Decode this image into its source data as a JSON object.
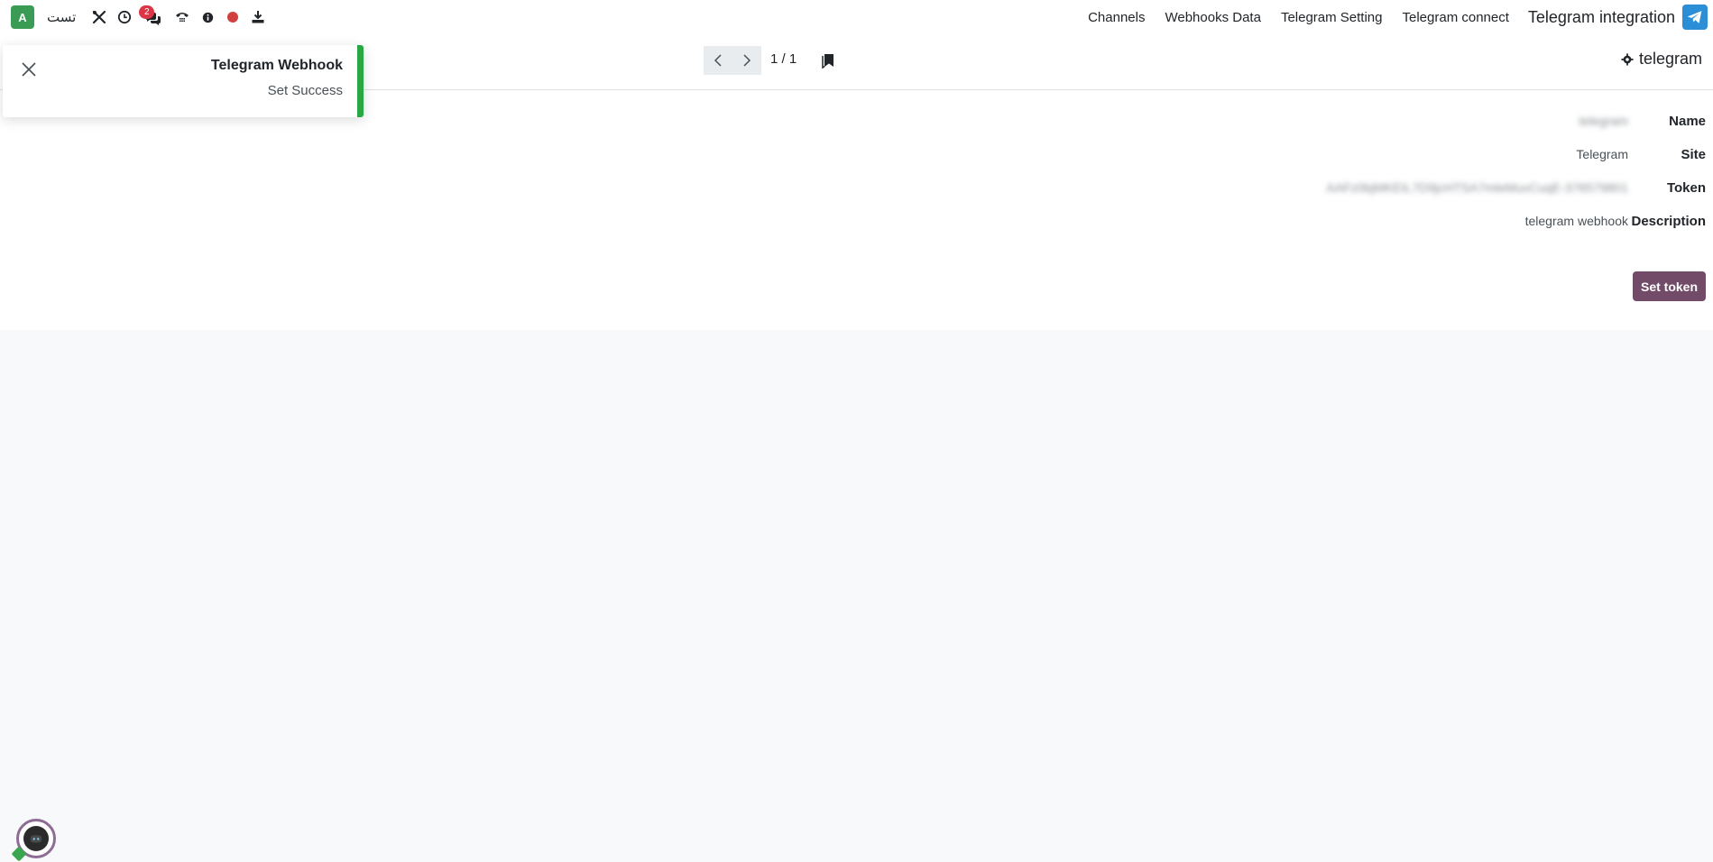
{
  "navbar": {
    "avatar_letter": "A",
    "company": "تست",
    "icons": [
      "tools-icon",
      "clock-icon",
      "chat-icon",
      "phone-icon",
      "info-icon",
      "record-dot-icon",
      "download-icon"
    ],
    "chat_badge": "2",
    "menu": [
      "Channels",
      "Webhooks Data",
      "Telegram Setting",
      "Telegram connect"
    ],
    "app_title": "Telegram integration",
    "accent": "#2c8ed6"
  },
  "control": {
    "pager_value": "1 / 1",
    "breadcrumb": "telegram"
  },
  "form": {
    "fields": [
      {
        "label": "Name",
        "value": "telegram"
      },
      {
        "label": "Site",
        "value": "Telegram"
      },
      {
        "label": "Token",
        "value": "AAFz0bjMKEIL7D9jcHTSA7mleMuvCuqE-376579801"
      },
      {
        "label": "Description",
        "value": "telegram webhook"
      }
    ],
    "set_token_label": "Set token",
    "button_color": "#714b67"
  },
  "toast": {
    "title": "Telegram Webhook",
    "message": "Set Success",
    "status_color": "#28a745"
  }
}
